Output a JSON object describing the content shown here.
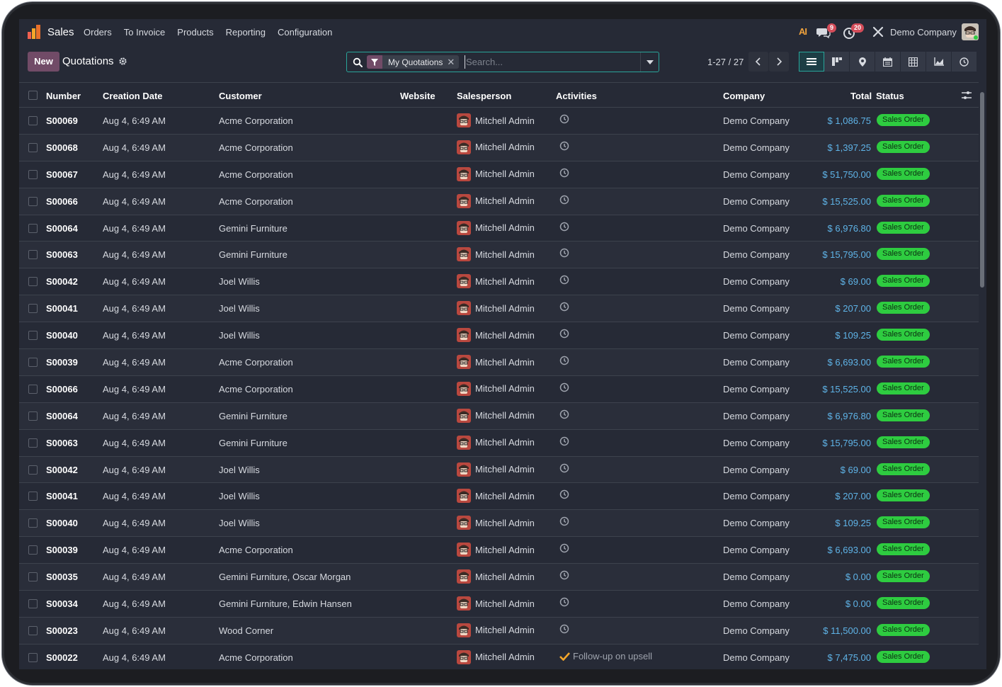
{
  "navbar": {
    "app_name": "Sales",
    "menu": [
      "Orders",
      "To Invoice",
      "Products",
      "Reporting",
      "Configuration"
    ],
    "ai_label": "AI",
    "messages_count": "9",
    "activities_count": "20",
    "company": "Demo Company"
  },
  "control": {
    "new_label": "New",
    "title": "Quotations",
    "facet_label": "My Quotations",
    "facet_close": "✕",
    "search_placeholder": "Search...",
    "pager": "1-27 / 27"
  },
  "columns": {
    "number": "Number",
    "creation_date": "Creation Date",
    "customer": "Customer",
    "website": "Website",
    "salesperson": "Salesperson",
    "activities": "Activities",
    "company": "Company",
    "total": "Total",
    "status": "Status"
  },
  "colors": {
    "accent": "#714b67",
    "teal": "#29a59a",
    "status_green": "#2ecc40",
    "amount_blue": "#5fb4e8"
  },
  "rows": [
    {
      "number": "S00069",
      "date": "Aug 4, 6:49 AM",
      "customer": "Acme Corporation",
      "salesperson": "Mitchell Admin",
      "activity": "",
      "company": "Demo Company",
      "total": "$ 1,086.75",
      "status": "Sales Order"
    },
    {
      "number": "S00068",
      "date": "Aug 4, 6:49 AM",
      "customer": "Acme Corporation",
      "salesperson": "Mitchell Admin",
      "activity": "",
      "company": "Demo Company",
      "total": "$ 1,397.25",
      "status": "Sales Order"
    },
    {
      "number": "S00067",
      "date": "Aug 4, 6:49 AM",
      "customer": "Acme Corporation",
      "salesperson": "Mitchell Admin",
      "activity": "",
      "company": "Demo Company",
      "total": "$ 51,750.00",
      "status": "Sales Order"
    },
    {
      "number": "S00066",
      "date": "Aug 4, 6:49 AM",
      "customer": "Acme Corporation",
      "salesperson": "Mitchell Admin",
      "activity": "",
      "company": "Demo Company",
      "total": "$ 15,525.00",
      "status": "Sales Order"
    },
    {
      "number": "S00064",
      "date": "Aug 4, 6:49 AM",
      "customer": "Gemini Furniture",
      "salesperson": "Mitchell Admin",
      "activity": "",
      "company": "Demo Company",
      "total": "$ 6,976.80",
      "status": "Sales Order"
    },
    {
      "number": "S00063",
      "date": "Aug 4, 6:49 AM",
      "customer": "Gemini Furniture",
      "salesperson": "Mitchell Admin",
      "activity": "",
      "company": "Demo Company",
      "total": "$ 15,795.00",
      "status": "Sales Order"
    },
    {
      "number": "S00042",
      "date": "Aug 4, 6:49 AM",
      "customer": "Joel Willis",
      "salesperson": "Mitchell Admin",
      "activity": "",
      "company": "Demo Company",
      "total": "$ 69.00",
      "status": "Sales Order"
    },
    {
      "number": "S00041",
      "date": "Aug 4, 6:49 AM",
      "customer": "Joel Willis",
      "salesperson": "Mitchell Admin",
      "activity": "",
      "company": "Demo Company",
      "total": "$ 207.00",
      "status": "Sales Order"
    },
    {
      "number": "S00040",
      "date": "Aug 4, 6:49 AM",
      "customer": "Joel Willis",
      "salesperson": "Mitchell Admin",
      "activity": "",
      "company": "Demo Company",
      "total": "$ 109.25",
      "status": "Sales Order"
    },
    {
      "number": "S00039",
      "date": "Aug 4, 6:49 AM",
      "customer": "Acme Corporation",
      "salesperson": "Mitchell Admin",
      "activity": "",
      "company": "Demo Company",
      "total": "$ 6,693.00",
      "status": "Sales Order"
    },
    {
      "number": "S00066",
      "date": "Aug 4, 6:49 AM",
      "customer": "Acme Corporation",
      "salesperson": "Mitchell Admin",
      "activity": "",
      "company": "Demo Company",
      "total": "$ 15,525.00",
      "status": "Sales Order"
    },
    {
      "number": "S00064",
      "date": "Aug 4, 6:49 AM",
      "customer": "Gemini Furniture",
      "salesperson": "Mitchell Admin",
      "activity": "",
      "company": "Demo Company",
      "total": "$ 6,976.80",
      "status": "Sales Order"
    },
    {
      "number": "S00063",
      "date": "Aug 4, 6:49 AM",
      "customer": "Gemini Furniture",
      "salesperson": "Mitchell Admin",
      "activity": "",
      "company": "Demo Company",
      "total": "$ 15,795.00",
      "status": "Sales Order"
    },
    {
      "number": "S00042",
      "date": "Aug 4, 6:49 AM",
      "customer": "Joel Willis",
      "salesperson": "Mitchell Admin",
      "activity": "",
      "company": "Demo Company",
      "total": "$ 69.00",
      "status": "Sales Order"
    },
    {
      "number": "S00041",
      "date": "Aug 4, 6:49 AM",
      "customer": "Joel Willis",
      "salesperson": "Mitchell Admin",
      "activity": "",
      "company": "Demo Company",
      "total": "$ 207.00",
      "status": "Sales Order"
    },
    {
      "number": "S00040",
      "date": "Aug 4, 6:49 AM",
      "customer": "Joel Willis",
      "salesperson": "Mitchell Admin",
      "activity": "",
      "company": "Demo Company",
      "total": "$ 109.25",
      "status": "Sales Order"
    },
    {
      "number": "S00039",
      "date": "Aug 4, 6:49 AM",
      "customer": "Acme Corporation",
      "salesperson": "Mitchell Admin",
      "activity": "",
      "company": "Demo Company",
      "total": "$ 6,693.00",
      "status": "Sales Order"
    },
    {
      "number": "S00035",
      "date": "Aug 4, 6:49 AM",
      "customer": "Gemini Furniture, Oscar Morgan",
      "salesperson": "Mitchell Admin",
      "activity": "",
      "company": "Demo Company",
      "total": "$ 0.00",
      "status": "Sales Order"
    },
    {
      "number": "S00034",
      "date": "Aug 4, 6:49 AM",
      "customer": "Gemini Furniture, Edwin Hansen",
      "salesperson": "Mitchell Admin",
      "activity": "",
      "company": "Demo Company",
      "total": "$ 0.00",
      "status": "Sales Order"
    },
    {
      "number": "S00023",
      "date": "Aug 4, 6:49 AM",
      "customer": "Wood Corner",
      "salesperson": "Mitchell Admin",
      "activity": "",
      "company": "Demo Company",
      "total": "$ 11,500.00",
      "status": "Sales Order"
    },
    {
      "number": "S00022",
      "date": "Aug 4, 6:49 AM",
      "customer": "Acme Corporation",
      "salesperson": "Mitchell Admin",
      "activity": "Follow-up on upsell",
      "company": "Demo Company",
      "total": "$ 7,475.00",
      "status": "Sales Order"
    }
  ]
}
